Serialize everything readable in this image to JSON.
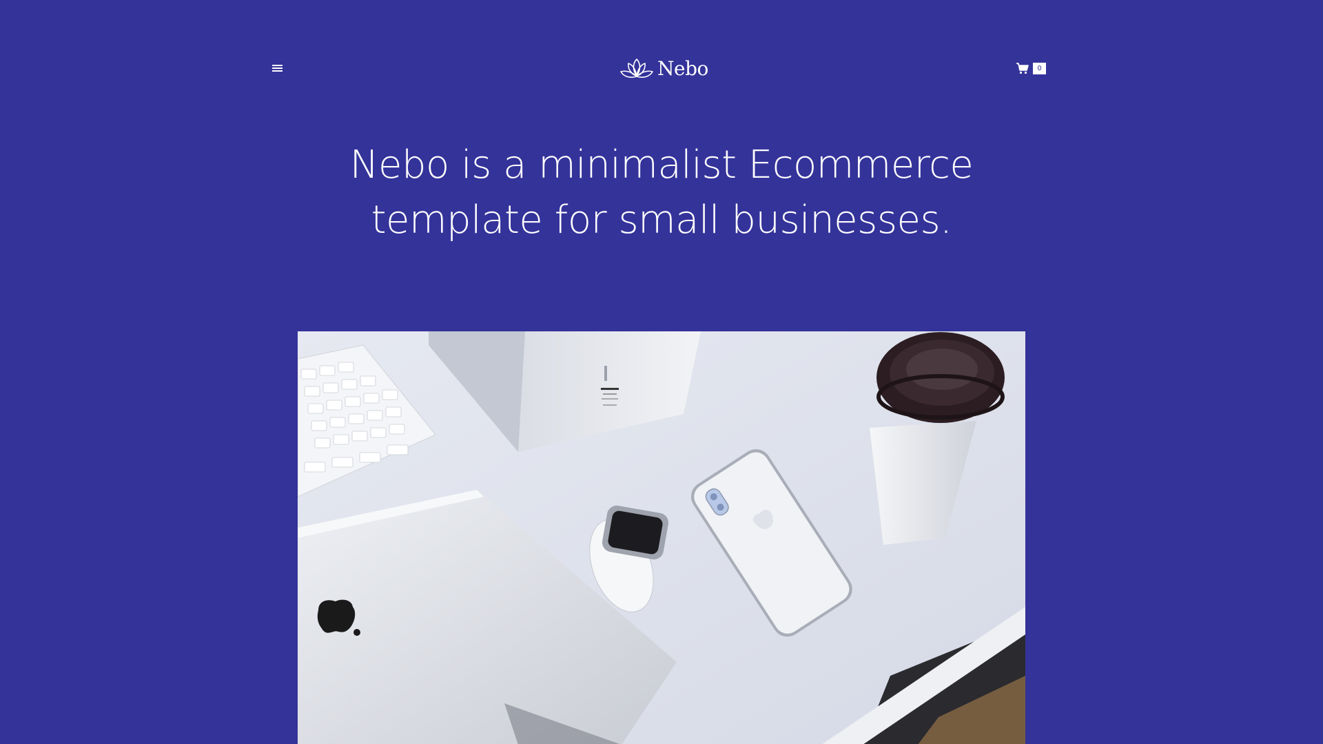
{
  "header": {
    "menu_icon": "hamburger-menu-icon",
    "logo_text": "Nebo",
    "logo_icon": "lotus-logo-icon",
    "cart_icon": "shopping-cart-icon",
    "cart_count": "0"
  },
  "hero": {
    "title_line1": "Nebo is a minimalist Ecommerce",
    "title_line2": "template for small businesses.",
    "image": "desk-with-laptop-watch-phone-coffee-photo"
  },
  "colors": {
    "background": "#34339a",
    "text": "#ffffff"
  }
}
